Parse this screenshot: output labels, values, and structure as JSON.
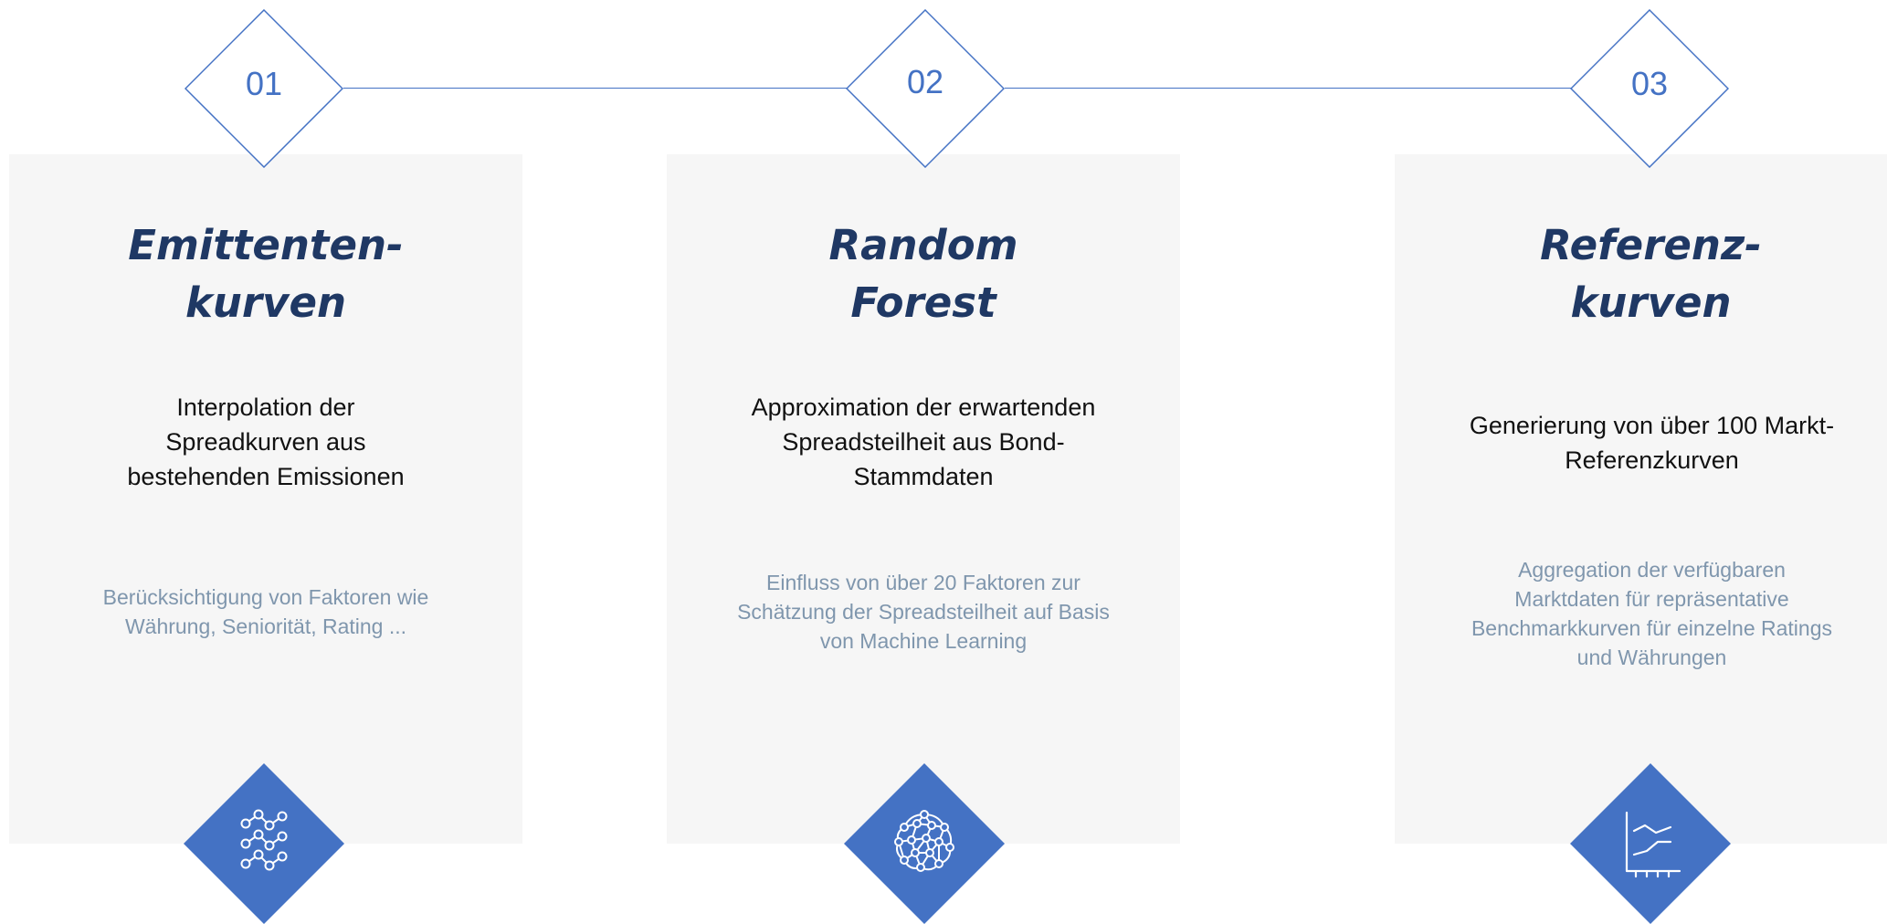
{
  "steps": [
    {
      "number": "01",
      "title": [
        "Emittenten-",
        "kurven"
      ],
      "subtitle": [
        "Interpolation der",
        "Spreadkurven aus",
        "bestehenden Emissionen"
      ],
      "description": [
        "Berücksichtigung von Faktoren wie",
        "Währung, Seniorität, Rating ..."
      ],
      "icon": "network-lines-icon"
    },
    {
      "number": "02",
      "title": [
        "Random",
        "Forest"
      ],
      "subtitle": [
        "Approximation der erwartenden",
        "Spreadsteilheit aus Bond-",
        "Stammdaten"
      ],
      "description": [
        "Einfluss von über 20 Faktoren zur",
        "Schätzung der Spreadsteilheit auf Basis",
        "von Machine Learning"
      ],
      "icon": "neural-brain-icon"
    },
    {
      "number": "03",
      "title": [
        "Referenz-",
        "kurven"
      ],
      "subtitle": [
        "Generierung von über 100 Markt-",
        "Referenzkurven"
      ],
      "description": [
        "Aggregation der verfügbaren",
        "Marktdaten für repräsentative",
        "Benchmarkkurven für einzelne Ratings",
        "und Währungen"
      ],
      "icon": "line-chart-icon"
    }
  ],
  "colors": {
    "accent": "#4472c4",
    "title": "#1f3864",
    "card_bg": "#f6f6f6",
    "desc_text": "#7f96ad"
  }
}
